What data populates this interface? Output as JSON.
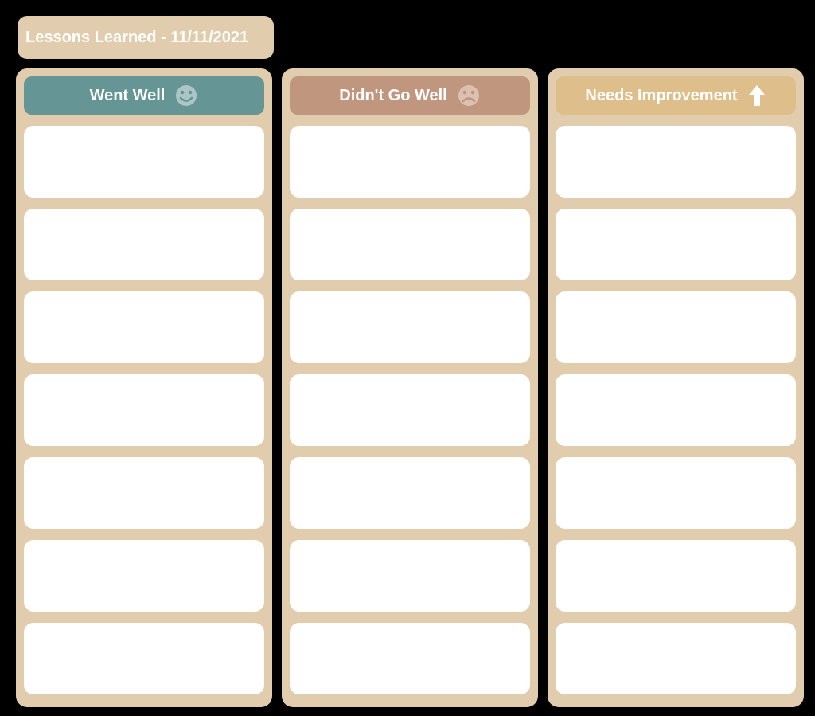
{
  "title": "Lessons Learned - 11/11/2021",
  "columns": [
    {
      "id": "went-well",
      "label": "Went Well",
      "icon": "smile",
      "header_color": "#659595",
      "cards": [
        "",
        "",
        "",
        "",
        "",
        "",
        ""
      ]
    },
    {
      "id": "didnt-go-well",
      "label": "Didn't Go Well",
      "icon": "frown",
      "header_color": "#c1967e",
      "cards": [
        "",
        "",
        "",
        "",
        "",
        "",
        ""
      ]
    },
    {
      "id": "needs-improvement",
      "label": "Needs Improvement",
      "icon": "arrow-up",
      "header_color": "#debf8b",
      "cards": [
        "",
        "",
        "",
        "",
        "",
        "",
        ""
      ]
    }
  ],
  "colors": {
    "panel_bg": "#e1cdad",
    "card_bg": "#ffffff",
    "text": "#ffffff"
  }
}
